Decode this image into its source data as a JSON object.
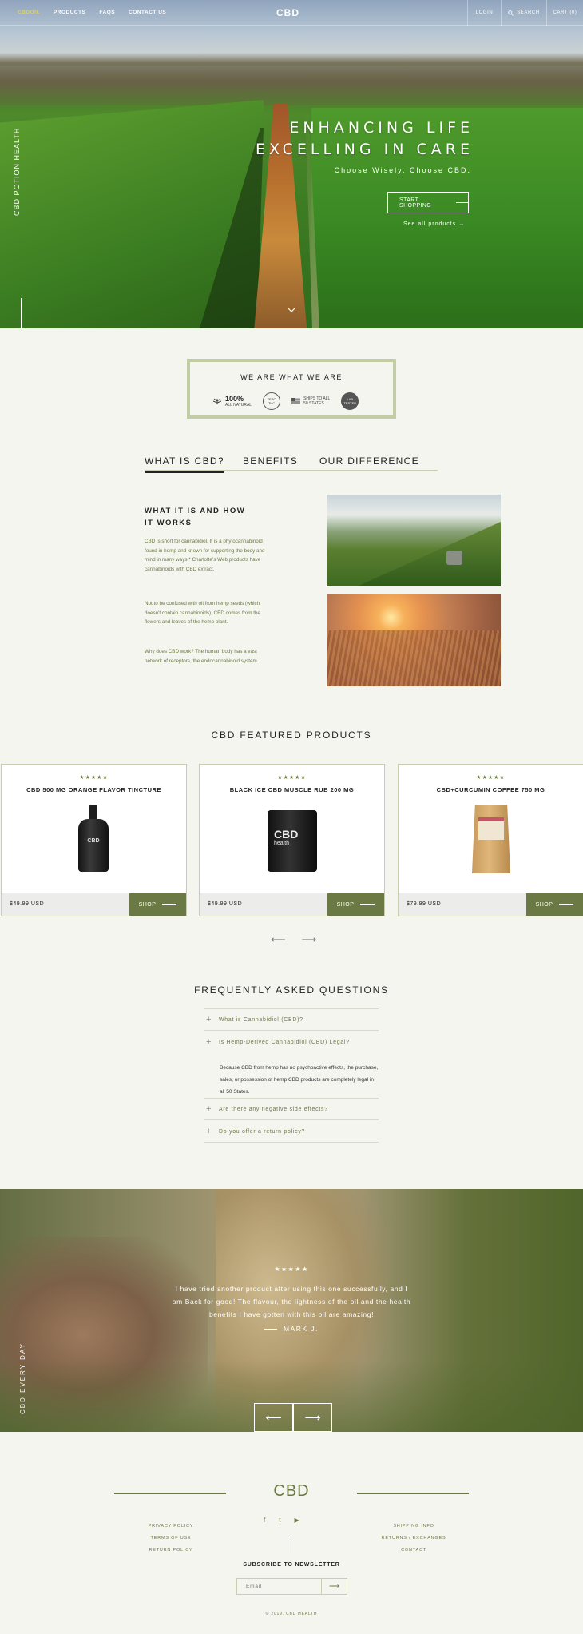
{
  "nav": {
    "links": [
      "CBDOIL",
      "PRODUCTS",
      "FAQS",
      "CONTACT US"
    ],
    "logo": "CBD",
    "login": "LOGIN",
    "search": "SEARCH",
    "cart": "CART (0)"
  },
  "hero": {
    "title_line1": "ENHANCING LIFE",
    "title_line2": "EXCELLING IN CARE",
    "subtitle": "Choose Wisely. Choose CBD.",
    "button": "START SHOPPING",
    "see_all": "See all products  →",
    "side_label": "CBD POTION HEALTH"
  },
  "badge": {
    "title": "WE ARE WHAT WE ARE",
    "items": [
      "100%",
      "ALL NATURAL",
      "ZERO",
      "THC",
      "SHIPS TO ALL",
      "50 STATES",
      "LAB TESTED"
    ]
  },
  "tabs": [
    "WHAT IS CBD?",
    "BENEFITS",
    "OUR DIFFERENCE"
  ],
  "about": {
    "heading1": "WHAT IT IS AND HOW",
    "heading2": "IT WORKS",
    "p1": "CBD is short for cannabidiol. It is a phytocannabinoid found in hemp and known for supporting the body and mind in many ways.* Charlotte's Web products have cannabinoids with CBD extract.",
    "p2": "Not to be confused with oil from hemp seeds (which doesn't contain cannabinoids), CBD comes from the flowers and leaves of the hemp plant.",
    "p3": "Why does CBD work? The human body has a vast network of receptors, the endocannabinoid system."
  },
  "products": {
    "title": "CBD FEATURED PRODUCTS",
    "shop_label": "SHOP",
    "items": [
      {
        "stars": "★★★★★",
        "name": "CBD 500 MG ORANGE FLAVOR TINCTURE",
        "price": "$49.99 USD",
        "image": "CBD"
      },
      {
        "stars": "★★★★★",
        "name": "BLACK ICE CBD MUSCLE RUB 200 MG",
        "price": "$49.99 USD",
        "image": "CBD",
        "image_sub": "health"
      },
      {
        "stars": "★★★★★",
        "name": "CBD+CURCUMIN COFFEE 750 MG",
        "price": "$79.99 USD"
      }
    ]
  },
  "faq": {
    "title": "FREQUENTLY ASKED QUESTIONS",
    "q1": "What is Cannabidiol (CBD)?",
    "q2": "Is Hemp-Derived Cannabidiol (CBD) Legal?",
    "answer": "Because CBD from hemp has no psychoactive effects, the purchase, sales, or possession of hemp CBD products are completely legal in all 50 States.",
    "q3": "Are there any negative side effects?",
    "q4": "Do you offer a return policy?"
  },
  "testimonial": {
    "stars": "★★★★★",
    "quote": "I have tried another product after using this one successfully, and I am Back for good! The flavour, the lightness of the oil and the health benefits I have gotten with this oil are amazing!",
    "author": "MARK J.",
    "side_label": "CBD EVERY DAY"
  },
  "footer": {
    "logo": "CBD",
    "left_links": [
      "PRIVACY POLICY",
      "TERMS OF USE",
      "RETURN POLICY"
    ],
    "right_links": [
      "SHIPPING INFO",
      "RETURNS / EXCHANGES",
      "CONTACT"
    ],
    "social": [
      "f",
      "t",
      "▶"
    ],
    "subscribe": "SUBSCRIBE TO NEWSLETTER",
    "email_placeholder": "Email",
    "copyright": "© 2019. CBD HEALTH"
  },
  "colors": {
    "accent": "#6b7a45",
    "background": "#f5f5f0"
  }
}
